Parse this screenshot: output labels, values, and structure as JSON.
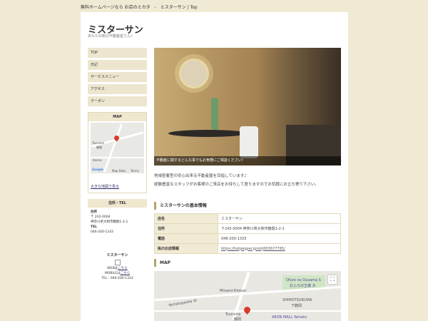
{
  "topbar": {
    "text": "無料ホームページなら お店のミカタ　-　ミスターサン | Top"
  },
  "site": {
    "title": "ミスターサン",
    "tagline": "あなたの街の不動産屋さん♪"
  },
  "nav": [
    {
      "label": "TOP"
    },
    {
      "label": "日記"
    },
    {
      "label": "サービスメニュー"
    },
    {
      "label": "アクセス"
    },
    {
      "label": "クーポン"
    }
  ],
  "map_box": {
    "title": "MAP",
    "link": "大きな地図で見る",
    "labels": {
      "place": "Tsuruma",
      "place_jp": "鶴間",
      "street": "Kanna",
      "logo": "Google",
      "map_data": "Map Data",
      "terms": "Terms"
    }
  },
  "address_box": {
    "title": "住所・TEL",
    "address_label": "住所",
    "zip": "〒 242-0004",
    "address": "神奈川県大和市鶴間1-2-1",
    "tel_label": "TEL",
    "tel": "046-200-1333"
  },
  "mr_box": {
    "title": "ミスターサン",
    "web_prefix": "WEBは",
    "web_link": "こちら",
    "mobile_prefix": "MOBILEは",
    "mobile_link": "こちら",
    "tel": "TEL：046-200-1333"
  },
  "hero": {
    "caption": "不動産に関するどんな事でもお気軽にご相談ください!"
  },
  "intro": {
    "line1": "地域密着型の安心出来る不動産屋を目指しています♪",
    "line2": "経験豊富なスタッフがお客様のご来店をお待ちして居りますのでお気軽にお立ち寄り下さい。"
  },
  "basic_info": {
    "heading": "ミスターサンの基本情報",
    "rows": [
      {
        "key": "店名",
        "value": "ミスターサン"
      },
      {
        "key": "住所",
        "value": "〒242-0004 神奈川県大和市鶴間1-2-1"
      },
      {
        "key": "電話",
        "value": "046-200-1333"
      },
      {
        "key": "街のお店情報",
        "value": "https://hotpepper.jp/strJ003677795/"
      }
    ]
  },
  "map_section": {
    "heading": "MAP",
    "labels": {
      "minami": "Minami-Rinkan",
      "shimo": "SHIMOTSURUMA",
      "shimo_jp": "下鶴間",
      "tsuruma": "Tsuruma",
      "tsuruma_jp": "鶴間",
      "ofuro": "Ofuro no Ousama S",
      "ofuro_jp": "おふろの王様 大",
      "aeon": "AEON MALL Yamato",
      "yamato_road": "Yamatogaoka St"
    }
  },
  "colors": {
    "background": "#f0ead4",
    "nav": "#ede6cf",
    "accent": "#b5a46a",
    "pin": "#d73b2a"
  }
}
